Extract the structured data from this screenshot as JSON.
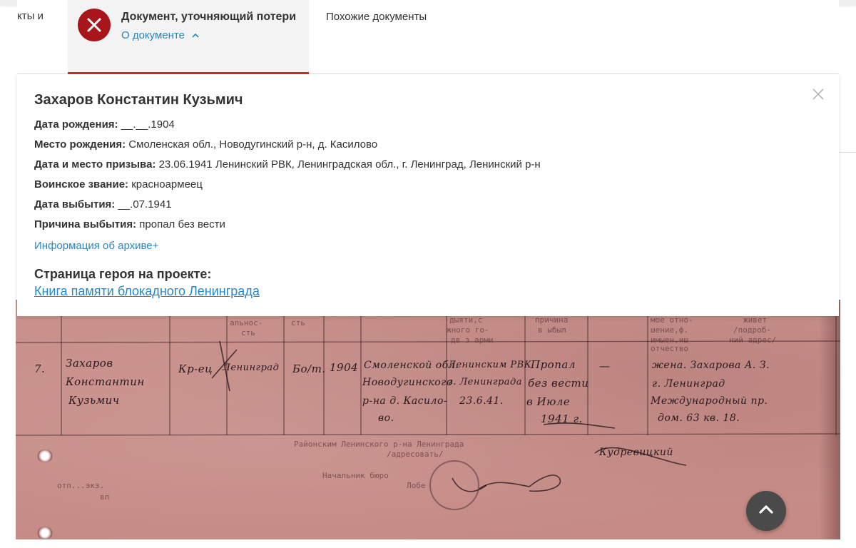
{
  "header": {
    "prev_tab_fragment": "кты и",
    "active_tab": {
      "title": "Документ, уточняющий потери",
      "link_label": "О документе",
      "icon": "error-x-icon"
    },
    "similar_tab_label": "Похожие документы"
  },
  "info": {
    "name": "Захаров Константин Кузьмич",
    "fields": [
      {
        "key": "Дата рождения:",
        "value": "__.__.1904"
      },
      {
        "key": "Место рождения:",
        "value": "Смоленская обл., Новодугинский р-н, д. Касилово"
      },
      {
        "key": "Дата и место призыва:",
        "value": "23.06.1941 Ленинский РВК, Ленинградская обл., г. Ленинград, Ленинский р-н"
      },
      {
        "key": "Воинское звание:",
        "value": "красноармеец"
      },
      {
        "key": "Дата выбытия:",
        "value": "__.07.1941"
      },
      {
        "key": "Причина выбытия:",
        "value": "пропал без вести"
      }
    ],
    "archive_link": "Информация об архиве+",
    "hero_title": "Страница героя на проекте:",
    "hero_link": "Книга памяти блокадного Ленинграда"
  },
  "scan": {
    "handwriting": [
      "7.",
      "Захаров",
      "Константин",
      "Кузьмич",
      "Кр-ец",
      "Ленинград",
      "Бо/т.",
      "1904",
      "Смоленской обл.",
      "Новодугинского",
      "р-на д. Касило-",
      "во.",
      "Ленинским РВК",
      "г. Ленинграда",
      "23.6.41.",
      "Пропал",
      "без вести",
      "в Июле",
      "1941 г.",
      "—",
      "жена. Захарова А. З.",
      "г. Ленинград",
      "Международный пр.",
      "дом. 63  кв. 18.",
      "Кудревицкий"
    ],
    "typed": [
      "альнос-",
      "сть",
      "сть",
      "дыяти,с",
      "жного го-",
      "дв з арми",
      "причина",
      "в ыбыл",
      "мое отно-",
      "шение,ф.",
      "имыен,иш",
      "отчество",
      "живет",
      "/подроб-",
      "ний адрес/",
      "Районским Ленинского р-на Ленинграда",
      "/адресовать/",
      "Начальник бюро",
      "Лобе",
      "отп...экз.",
      "вл"
    ]
  },
  "controls": {
    "close_icon": "close-icon",
    "scroll_top_icon": "chevron-up-icon"
  },
  "colors": {
    "accent_red": "#d6262b",
    "error_icon_bg": "#a8161b",
    "link_blue": "#2a86c0",
    "scan_tint": "#c88f8a"
  }
}
